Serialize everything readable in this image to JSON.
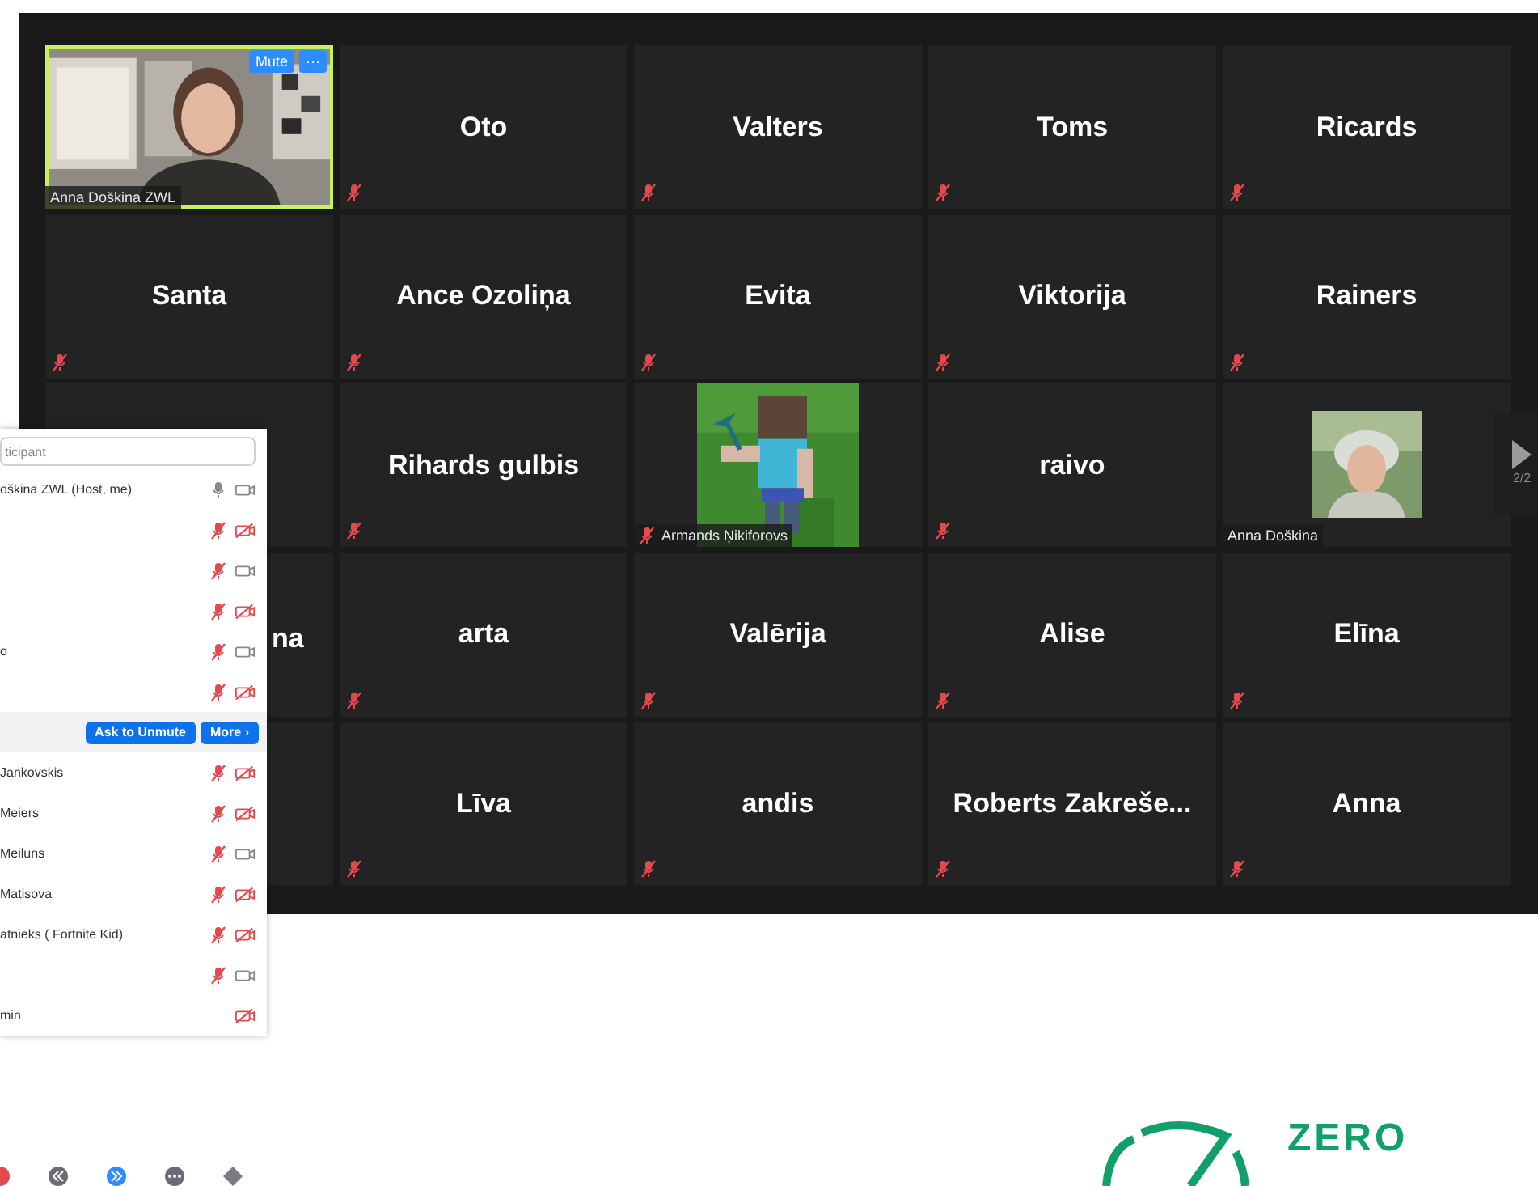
{
  "meeting": {
    "tiles": [
      {
        "kind": "video",
        "name": "Anna Doškina ZWL",
        "muted": false,
        "speaking": true,
        "buttons": [
          "Mute",
          "···"
        ]
      },
      {
        "kind": "name",
        "name": "Oto",
        "muted": true,
        "speaking": false
      },
      {
        "kind": "name",
        "name": "Valters",
        "muted": true,
        "speaking": false
      },
      {
        "kind": "name",
        "name": "Toms",
        "muted": true,
        "speaking": false
      },
      {
        "kind": "name",
        "name": "Ricards",
        "muted": true,
        "speaking": false
      },
      {
        "kind": "name",
        "name": "Santa",
        "muted": true,
        "speaking": false
      },
      {
        "kind": "name",
        "name": "Ance Ozoliņa",
        "muted": true,
        "speaking": false
      },
      {
        "kind": "name",
        "name": "Evita",
        "muted": true,
        "speaking": false
      },
      {
        "kind": "name",
        "name": "Viktorija",
        "muted": true,
        "speaking": false
      },
      {
        "kind": "name",
        "name": "Rainers",
        "muted": true,
        "speaking": false
      },
      {
        "kind": "covered",
        "muted": false,
        "speaking": false
      },
      {
        "kind": "name",
        "name": "Rihards gulbis",
        "muted": true,
        "speaking": false
      },
      {
        "name": "Armands Ņikiforovs",
        "muted": true,
        "speaking": false
      },
      {
        "kind": "name",
        "name": "raivo",
        "muted": true,
        "speaking": false
      },
      {
        "kind": "avatar",
        "name": "Anna Doškina",
        "muted": false,
        "speaking": false
      },
      {
        "kind": "partial",
        "name": "na",
        "muted": false,
        "speaking": false
      },
      {
        "kind": "name",
        "name": "arta",
        "muted": true,
        "speaking": false
      },
      {
        "kind": "name",
        "name": "Valērija",
        "muted": true,
        "speaking": false
      },
      {
        "kind": "name",
        "name": "Alise",
        "muted": true,
        "speaking": false
      },
      {
        "kind": "name",
        "name": "Elīna",
        "muted": true,
        "speaking": false
      },
      {
        "kind": "covered",
        "muted": false,
        "speaking": false
      },
      {
        "kind": "name",
        "name": "Līva",
        "muted": true,
        "speaking": false
      },
      {
        "kind": "name",
        "name": "andis",
        "muted": true,
        "speaking": false
      },
      {
        "kind": "name",
        "name": "Roberts  Zakreše...",
        "muted": true,
        "speaking": false
      },
      {
        "kind": "name",
        "name": "Anna",
        "muted": true,
        "speaking": false
      }
    ],
    "page_nav": {
      "label": "2/2"
    }
  },
  "participants_panel": {
    "search": {
      "placeholder": "ticipant"
    },
    "rows": [
      {
        "name": "oškina ZWL (Host, me)",
        "audio": true,
        "muted": false,
        "video": true,
        "hovered": false
      },
      {
        "audio": true,
        "muted": true,
        "video": false,
        "hovered": false
      },
      {
        "audio": true,
        "muted": true,
        "video": true,
        "hovered": false
      },
      {
        "audio": true,
        "muted": true,
        "video": false,
        "hovered": false
      },
      {
        "name": "o",
        "audio": true,
        "muted": true,
        "video": true,
        "hovered": false
      },
      {
        "audio": true,
        "muted": true,
        "video": false,
        "hovered": false
      },
      {
        "hovered": true,
        "buttons": [
          "Ask to Unmute",
          "More ›"
        ]
      },
      {
        "name": "Jankovskis",
        "audio": true,
        "muted": true,
        "video": false,
        "hovered": false
      },
      {
        "name": "Meiers",
        "audio": true,
        "muted": true,
        "video": false,
        "hovered": false
      },
      {
        "name": "Meiluns",
        "audio": true,
        "muted": true,
        "video": true,
        "hovered": false
      },
      {
        "name": "Matisova",
        "audio": true,
        "muted": true,
        "video": false,
        "hovered": false
      },
      {
        "name": "atnieks ( Fortnite Kid)",
        "audio": true,
        "muted": true,
        "video": false,
        "hovered": false
      },
      {
        "audio": true,
        "muted": true,
        "video": true,
        "hovered": false
      },
      {
        "name": "min",
        "audio": false,
        "video": false,
        "hovered": false
      }
    ]
  },
  "logo": {
    "text": "ZERO"
  }
}
